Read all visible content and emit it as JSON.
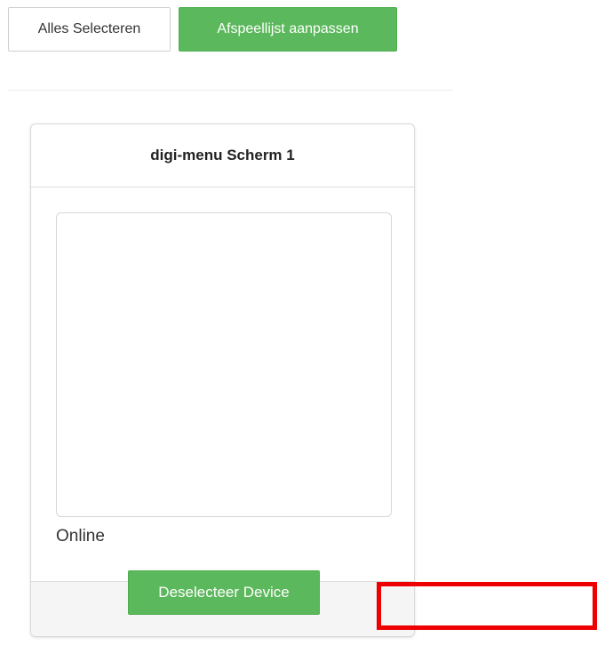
{
  "toolbar": {
    "select_all_label": "Alles Selecteren",
    "edit_playlist_label": "Afspeellijst aanpassen"
  },
  "device": {
    "name": "digi-menu Scherm 1",
    "status": "Online",
    "deselect_label": "Deselecteer Device"
  },
  "colors": {
    "success_green": "#5cb85c",
    "highlight_red": "#ee0000"
  }
}
